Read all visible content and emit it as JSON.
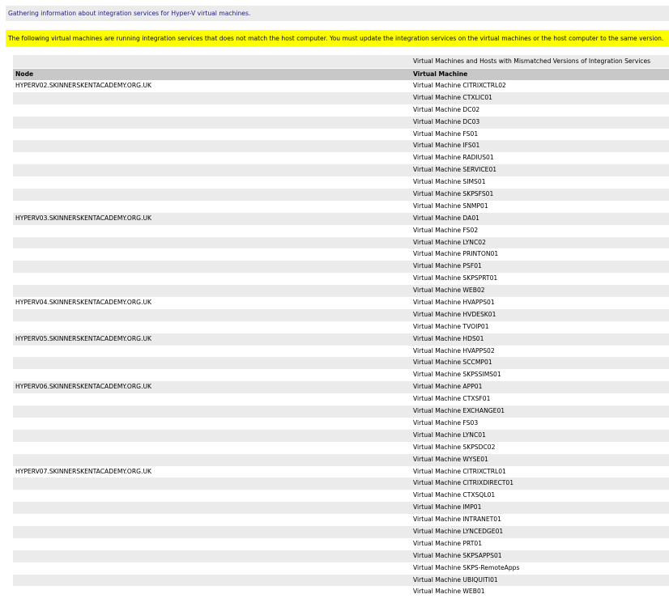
{
  "info_message": "Gathering information about integration services for Hyper-V virtual machines.",
  "warning_message": "The following virtual machines are running integration services that does not match the host computer. You must update the integration services on the virtual machines or the host computer to the same version.",
  "table": {
    "caption": "Virtual Machines and Hosts with Mismatched Versions of Integration Services",
    "headers": {
      "node": "Node",
      "vm": "Virtual Machine"
    },
    "rows": [
      {
        "node": "HYPERV02.SKINNERSKENTACADEMY.ORG.UK",
        "vm": "Virtual Machine CITRIXCTRL02"
      },
      {
        "node": "",
        "vm": "Virtual Machine CTXLIC01"
      },
      {
        "node": "",
        "vm": "Virtual Machine DC02"
      },
      {
        "node": "",
        "vm": "Virtual Machine DC03"
      },
      {
        "node": "",
        "vm": "Virtual Machine FS01"
      },
      {
        "node": "",
        "vm": "Virtual Machine IFS01"
      },
      {
        "node": "",
        "vm": "Virtual Machine RADIUS01"
      },
      {
        "node": "",
        "vm": "Virtual Machine SERVICE01"
      },
      {
        "node": "",
        "vm": "Virtual Machine SIMS01"
      },
      {
        "node": "",
        "vm": "Virtual Machine SKPSFS01"
      },
      {
        "node": "",
        "vm": "Virtual Machine SNMP01"
      },
      {
        "node": "HYPERV03.SKINNERSKENTACADEMY.ORG.UK",
        "vm": "Virtual Machine DA01"
      },
      {
        "node": "",
        "vm": "Virtual Machine FS02"
      },
      {
        "node": "",
        "vm": "Virtual Machine LYNC02"
      },
      {
        "node": "",
        "vm": "Virtual Machine PRINTON01"
      },
      {
        "node": "",
        "vm": "Virtual Machine PSF01"
      },
      {
        "node": "",
        "vm": "Virtual Machine SKPSPRT01"
      },
      {
        "node": "",
        "vm": "Virtual Machine WEB02"
      },
      {
        "node": "HYPERV04.SKINNERSKENTACADEMY.ORG.UK",
        "vm": "Virtual Machine HVAPPS01"
      },
      {
        "node": "",
        "vm": "Virtual Machine HVDESK01"
      },
      {
        "node": "",
        "vm": "Virtual Machine TVOIP01"
      },
      {
        "node": "HYPERV05.SKINNERSKENTACADEMY.ORG.UK",
        "vm": "Virtual Machine HDS01"
      },
      {
        "node": "",
        "vm": "Virtual Machine HVAPPS02"
      },
      {
        "node": "",
        "vm": "Virtual Machine SCCMP01"
      },
      {
        "node": "",
        "vm": "Virtual Machine SKPSSIMS01"
      },
      {
        "node": "HYPERV06.SKINNERSKENTACADEMY.ORG.UK",
        "vm": "Virtual Machine APP01"
      },
      {
        "node": "",
        "vm": "Virtual Machine CTXSF01"
      },
      {
        "node": "",
        "vm": "Virtual Machine EXCHANGE01"
      },
      {
        "node": "",
        "vm": "Virtual Machine FS03"
      },
      {
        "node": "",
        "vm": "Virtual Machine LYNC01"
      },
      {
        "node": "",
        "vm": "Virtual Machine SKPSDC02"
      },
      {
        "node": "",
        "vm": "Virtual Machine WYSE01"
      },
      {
        "node": "HYPERV07.SKINNERSKENTACADEMY.ORG.UK",
        "vm": "Virtual Machine CITRIXCTRL01"
      },
      {
        "node": "",
        "vm": "Virtual Machine CITRIXDIRECT01"
      },
      {
        "node": "",
        "vm": "Virtual Machine CTXSQL01"
      },
      {
        "node": "",
        "vm": "Virtual Machine IMP01"
      },
      {
        "node": "",
        "vm": "Virtual Machine INTRANET01"
      },
      {
        "node": "",
        "vm": "Virtual Machine LYNCEDGE01"
      },
      {
        "node": "",
        "vm": "Virtual Machine PRT01"
      },
      {
        "node": "",
        "vm": "Virtual Machine SKPSAPPS01"
      },
      {
        "node": "",
        "vm": "Virtual Machine SKPS-RemoteApps"
      },
      {
        "node": "",
        "vm": "Virtual Machine UBIQUITI01"
      },
      {
        "node": "",
        "vm": "Virtual Machine WEB01"
      }
    ]
  }
}
